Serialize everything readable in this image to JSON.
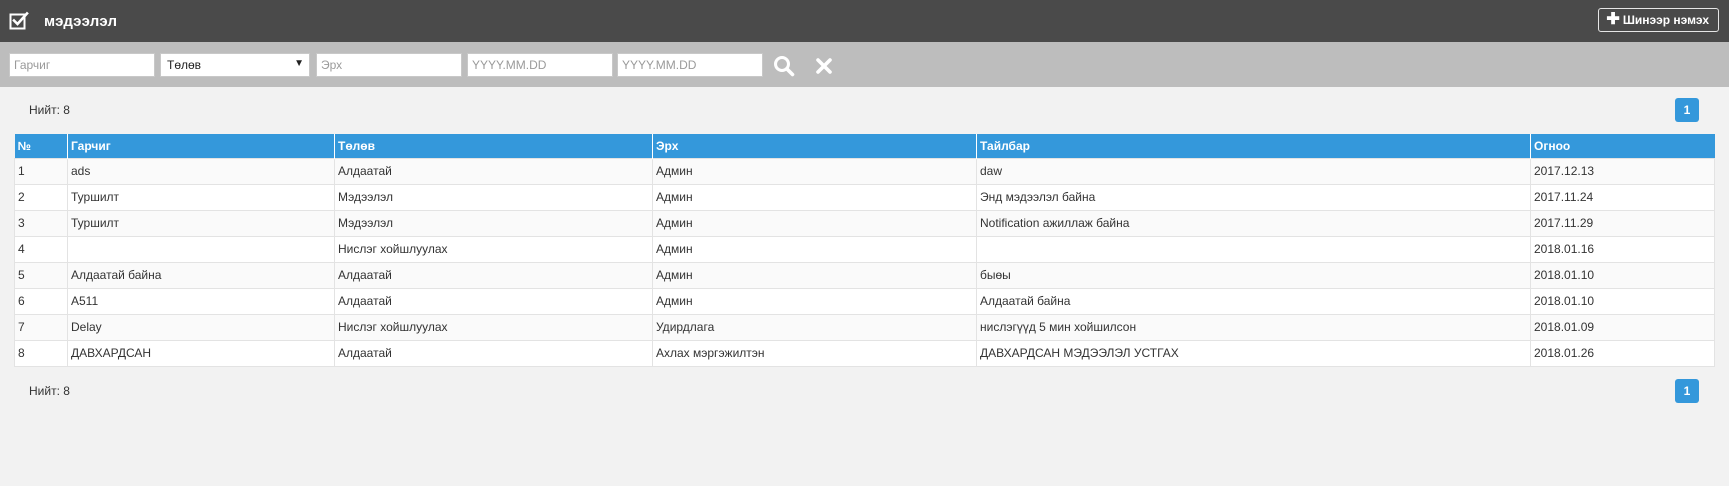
{
  "header": {
    "title": "мэдээлэл",
    "add_button": "Шинээр нэмэх"
  },
  "filters": {
    "title_placeholder": "Гарчиг",
    "status_selected": "Төлөв",
    "role_placeholder": "Эрх",
    "date_from_placeholder": "YYYY.MM.DD",
    "date_to_placeholder": "YYYY.MM.DD"
  },
  "summary": {
    "total_top": "Нийт: 8",
    "total_bottom": "Нийт: 8",
    "page": "1"
  },
  "table": {
    "columns": [
      "№",
      "Гарчиг",
      "Төлөв",
      "Эрх",
      "Тайлбар",
      "Огноо"
    ],
    "rows": [
      [
        "1",
        "ads",
        "Алдаатай",
        "Админ",
        "daw",
        "2017.12.13"
      ],
      [
        "2",
        "Туршилт",
        "Мэдээлэл",
        "Админ",
        "Энд мэдээлэл байна",
        "2017.11.24"
      ],
      [
        "3",
        "Туршилт",
        "Мэдээлэл",
        "Админ",
        "Notification ажиллаж байна",
        "2017.11.29"
      ],
      [
        "4",
        "",
        "Нислэг хойшлуулах",
        "Админ",
        "",
        "2018.01.16"
      ],
      [
        "5",
        "Алдаатай байна",
        "Алдаатай",
        "Админ",
        "быөы",
        "2018.01.10"
      ],
      [
        "6",
        "A511",
        "Алдаатай",
        "Админ",
        "Алдаатай байна",
        "2018.01.10"
      ],
      [
        "7",
        "Delay",
        "Нислэг хойшлуулах",
        "Удирдлага",
        "нислэгүүд 5 мин хойшилсон",
        "2018.01.09"
      ],
      [
        "8",
        "ДАВХАРДСАН",
        "Алдаатай",
        "Ахлах мэргэжилтэн",
        "ДАВХАРДСАН МЭДЭЭЛЭЛ УСТГАХ",
        "2018.01.26"
      ]
    ]
  },
  "icons": {
    "app": "checkbox-icon",
    "add": "plus-icon",
    "search": "search-icon",
    "clear": "close-icon",
    "dropdown": "caret-down-icon"
  },
  "colors": {
    "header_bg": "#4a4a4a",
    "filter_bg": "#bdbdbd",
    "accent": "#3498db"
  }
}
